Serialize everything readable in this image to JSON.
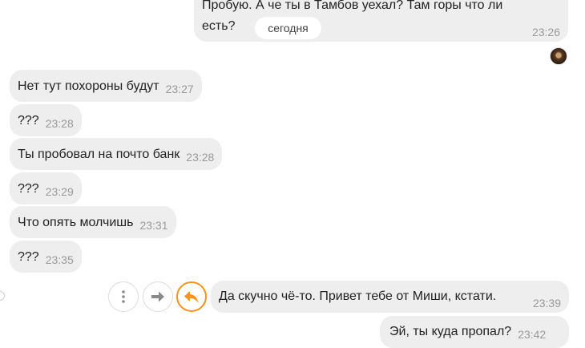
{
  "date_pill": "сегодня",
  "messages": [
    {
      "id": "out_top",
      "direction": "out",
      "line1": "Пробую. А че ты в Тамбов уехал? Там горы что ли",
      "line2": "есть?",
      "time": "23:26"
    },
    {
      "id": "in_1",
      "direction": "in",
      "text": "Нет  тут похороны будут",
      "time": "23:27"
    },
    {
      "id": "in_2",
      "direction": "in",
      "text": "???",
      "time": "23:28"
    },
    {
      "id": "in_3",
      "direction": "in",
      "text": "Ты пробовал на почто банк",
      "time": "23:28"
    },
    {
      "id": "in_4",
      "direction": "in",
      "text": "???",
      "time": "23:29"
    },
    {
      "id": "in_5",
      "direction": "in",
      "text": "Что опять молчишь",
      "time": "23:31"
    },
    {
      "id": "in_6",
      "direction": "in",
      "text": "???",
      "time": "23:35"
    },
    {
      "id": "out_1",
      "direction": "out",
      "text": "Да скучно чё-то. Привет тебе от Миши, кстати.",
      "time": "23:39"
    },
    {
      "id": "out_2",
      "direction": "out",
      "text": "Эй, ты куда пропал?",
      "time": "23:42"
    }
  ],
  "message_actions": [
    {
      "name": "more-options",
      "icon": "vertical-dots-icon"
    },
    {
      "name": "forward",
      "icon": "arrow-right-icon"
    },
    {
      "name": "reply",
      "icon": "reply-arrow-icon",
      "color": "#f7931e"
    }
  ],
  "colors": {
    "bubble": "#eeeeee",
    "time": "#9a9a9a",
    "accent": "#f7931e"
  }
}
